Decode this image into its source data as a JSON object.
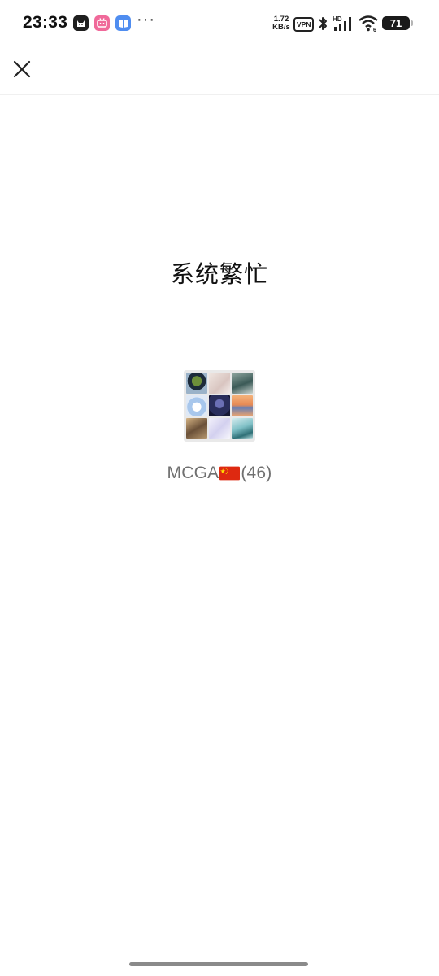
{
  "status_bar": {
    "time": "23:33",
    "more": "···",
    "net_speed_value": "1.72",
    "net_speed_unit": "KB/s",
    "vpn": "VPN",
    "signal_label": "HD",
    "wifi_label": "6",
    "battery_level": "71",
    "app_icons": [
      "cat-app-icon",
      "bilibili-icon",
      "reader-app-icon"
    ]
  },
  "nav": {
    "close_icon": "close-icon"
  },
  "main": {
    "message": "系统繁忙",
    "group": {
      "name_prefix": "MCGA",
      "flag_icon": "china-flag-icon",
      "member_count": "(46)"
    }
  },
  "colors": {
    "flag_red": "#de2910",
    "flag_yellow": "#ffde00",
    "name_text": "#707070"
  }
}
